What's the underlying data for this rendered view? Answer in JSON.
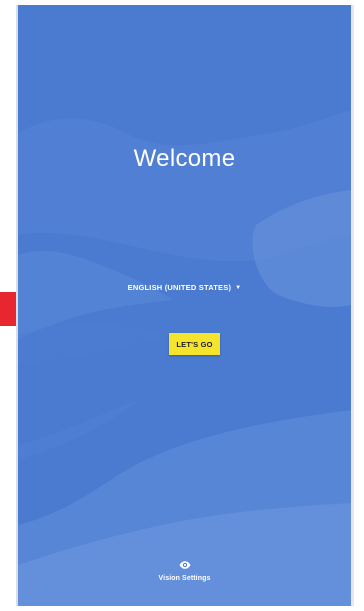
{
  "screen": {
    "title": "Welcome",
    "language": {
      "selected": "ENGLISH (UNITED STATES)",
      "caret_icon": "dropdown-caret-icon"
    },
    "start_button": {
      "label": "LET'S GO",
      "color": "#f4e52c"
    },
    "accessibility": {
      "label": "Vision Settings",
      "icon": "eye-icon"
    }
  },
  "colors": {
    "background": "#4a7bd0",
    "text": "#ffffff"
  }
}
